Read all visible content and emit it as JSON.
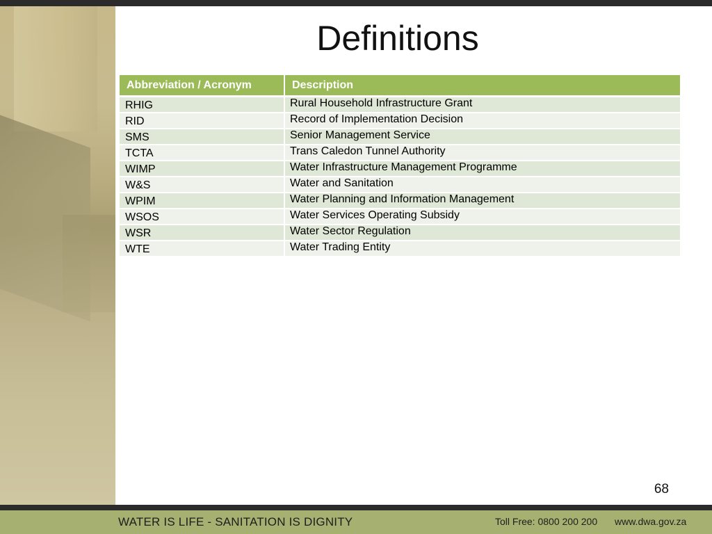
{
  "slide": {
    "title": "Definitions",
    "page_number": "68"
  },
  "table": {
    "headers": [
      "Abbreviation / Acronym",
      "Description"
    ],
    "rows": [
      {
        "abbr": "RHIG",
        "desc": "Rural Household Infrastructure Grant"
      },
      {
        "abbr": "RID",
        "desc": "Record of Implementation Decision"
      },
      {
        "abbr": "SMS",
        "desc": "Senior Management Service"
      },
      {
        "abbr": "TCTA",
        "desc": "Trans Caledon Tunnel Authority"
      },
      {
        "abbr": "WIMP",
        "desc": "Water Infrastructure Management Programme"
      },
      {
        "abbr": "W&S",
        "desc": "Water and Sanitation"
      },
      {
        "abbr": "WPIM",
        "desc": "Water Planning and Information Management"
      },
      {
        "abbr": "WSOS",
        "desc": "Water Services Operating Subsidy"
      },
      {
        "abbr": "WSR",
        "desc": "Water Sector Regulation"
      },
      {
        "abbr": "WTE",
        "desc": "Water Trading Entity"
      }
    ]
  },
  "footer": {
    "slogan": "WATER IS LIFE - SANITATION IS DIGNITY",
    "toll_free": "Toll Free: 0800 200 200",
    "website": "www.dwa.gov.za"
  },
  "colors": {
    "header_green": "#9bbb59",
    "footer_olive": "#a6b070",
    "row_odd": "#dfe7d6",
    "row_even": "#eef2ea"
  }
}
